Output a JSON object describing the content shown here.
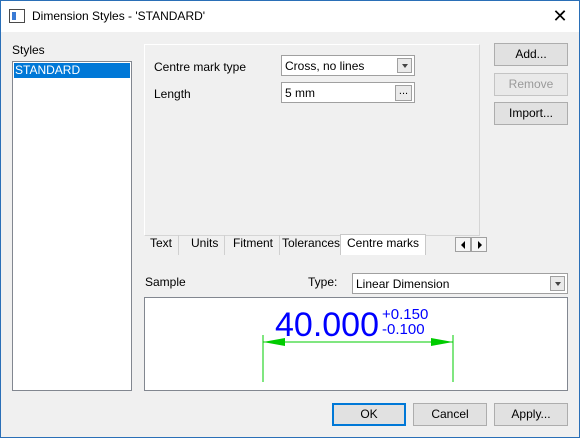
{
  "window": {
    "title": "Dimension Styles - 'STANDARD'",
    "close_glyph": "✕"
  },
  "styles": {
    "label": "Styles",
    "items": [
      "STANDARD"
    ],
    "selected": "STANDARD"
  },
  "side_buttons": {
    "add": "Add...",
    "remove": "Remove",
    "import": "Import..."
  },
  "centre_marks": {
    "type_label": "Centre mark type",
    "type_value": "Cross, no lines",
    "length_label": "Length",
    "length_value": "5 mm",
    "ellipsis": "..."
  },
  "tabs": [
    {
      "label": "Text",
      "active": false
    },
    {
      "label": "Units",
      "active": false
    },
    {
      "label": "Fitment",
      "active": false
    },
    {
      "label": "Tolerances",
      "active": false
    },
    {
      "label": "Centre marks",
      "active": true
    }
  ],
  "sample": {
    "label": "Sample",
    "type_label": "Type:",
    "type_value": "Linear Dimension",
    "main_value": "40.000",
    "tol_upper": "+0.150",
    "tol_lower": "-0.100",
    "text_color": "#0000ff",
    "line_color": "#00cc00"
  },
  "footer": {
    "ok": "OK",
    "cancel": "Cancel",
    "apply": "Apply..."
  },
  "icons": {
    "app": "dialog-window-icon",
    "close": "close-icon",
    "dropdown": "chevron-down-icon",
    "tab_left": "arrow-left-icon",
    "tab_right": "arrow-right-icon"
  }
}
